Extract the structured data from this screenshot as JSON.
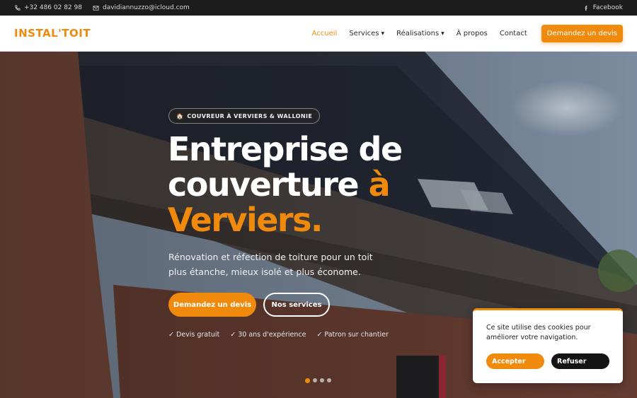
{
  "topbar": {
    "phone": "+32 486 02 82 98",
    "email": "davidiannuzzo@icloud.com",
    "facebook": "Facebook"
  },
  "header": {
    "logo": "INSTAL'TOIT",
    "nav": {
      "home": "Accueil",
      "services": "Services",
      "realisations": "Réalisations",
      "about": "À propos",
      "contact": "Contact"
    },
    "cta": "Demandez un devis"
  },
  "hero": {
    "badge_icon": "🏠",
    "badge": "COUVREUR À VERVIERS & WALLONIE",
    "title_line1": "Entreprise de",
    "title_line2": "couverture",
    "title_accent1": "à",
    "title_accent2": "Verviers.",
    "subtitle": "Rénovation et réfection de toiture pour un toit plus étanche, mieux isolé et plus économe.",
    "btn_primary": "Demandez un devis",
    "btn_secondary": "Nos services",
    "features": [
      "✓ Devis gratuit",
      "✓ 30 ans d'expérience",
      "✓ Patron sur chantier"
    ]
  },
  "slider": {
    "count": 4,
    "active_index": 0
  },
  "cookie": {
    "text": "Ce site utilise des cookies pour améliorer votre navigation.",
    "accept": "Accepter",
    "refuse": "Refuser"
  },
  "colors": {
    "accent": "#f08a0c",
    "dark": "#1c1c1c"
  }
}
